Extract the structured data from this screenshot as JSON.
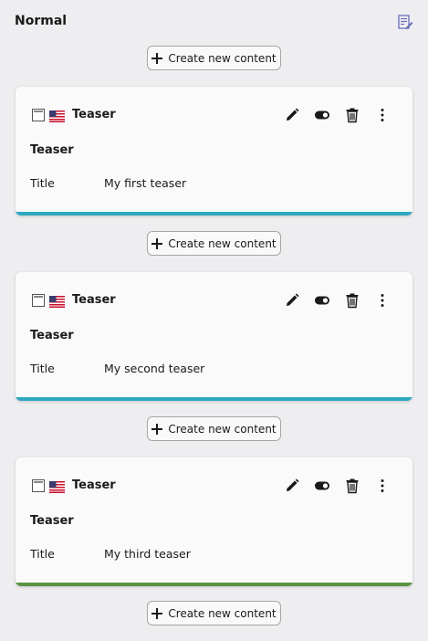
{
  "column": {
    "title": "Normal"
  },
  "new_content_label": "Create new content",
  "colors": {
    "background": "#eeeef0",
    "bar_blue": "#2ea8c0",
    "bar_green": "#5b9345"
  },
  "cards": [
    {
      "type_label": "Teaser",
      "heading": "Teaser",
      "field_label": "Title",
      "field_value": "My first teaser",
      "status_color": "#2ea8c0"
    },
    {
      "type_label": "Teaser",
      "heading": "Teaser",
      "field_label": "Title",
      "field_value": "My second teaser",
      "status_color": "#2ea8c0"
    },
    {
      "type_label": "Teaser",
      "heading": "Teaser",
      "field_label": "Title",
      "field_value": "My third teaser",
      "status_color": "#5b9345"
    }
  ],
  "icons": {
    "column_edit": "edit-column-icon",
    "content_type": "content-type-icon",
    "language": "us-flag-icon",
    "edit": "pencil-icon",
    "toggle": "toggle-visibility-icon",
    "delete": "trash-icon",
    "more": "more-vertical-icon"
  }
}
